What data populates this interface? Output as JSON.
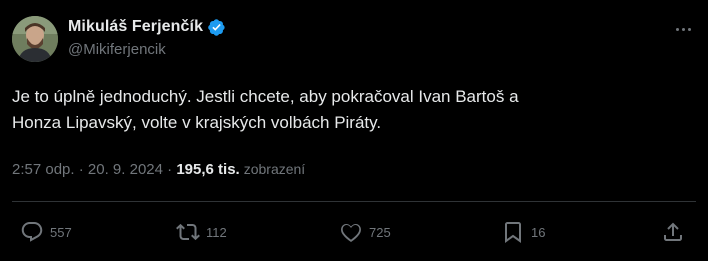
{
  "author": {
    "display_name": "Mikuláš Ferjenčík",
    "handle": "@Mikiferjencik",
    "verified": true
  },
  "tweet": {
    "text_line1": "Je to úplně jednoduchý. Jestli chcete, aby pokračoval Ivan Bartoš a",
    "text_line2": "Honza Lipavský, volte v krajských volbách Piráty."
  },
  "meta": {
    "time": "2:57 odp.",
    "separator": " · ",
    "date": "20. 9. 2024",
    "separator2": " · ",
    "views_count": "195,6 tis.",
    "views_label": "zobrazení"
  },
  "actions": {
    "reply_count": "557",
    "retweet_count": "112",
    "like_count": "725",
    "bookmark_count": "16"
  },
  "icons": [
    "verified-icon",
    "more-icon",
    "reply-icon",
    "retweet-icon",
    "like-icon",
    "bookmark-icon",
    "share-icon"
  ],
  "colors": {
    "background": "#000000",
    "text": "#e7e9ea",
    "muted": "#71767b",
    "verified": "#1d9bf0",
    "divider": "#2f3336"
  }
}
